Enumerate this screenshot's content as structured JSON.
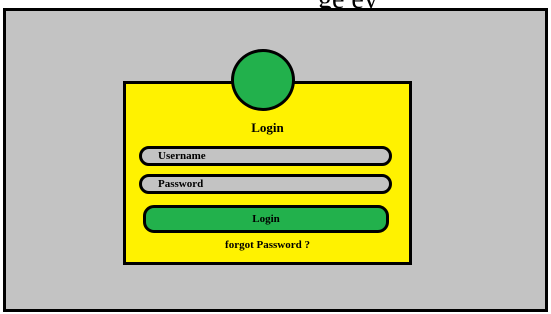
{
  "header": {
    "partial_text": "ge   ey"
  },
  "login": {
    "title": "Login",
    "username_placeholder": "Username",
    "password_placeholder": "Password",
    "button_label": "Login",
    "forgot_link": "forgot Password ?"
  },
  "colors": {
    "background": "#c3c3c3",
    "card": "#fff200",
    "accent": "#22b14c",
    "border": "#000000"
  }
}
